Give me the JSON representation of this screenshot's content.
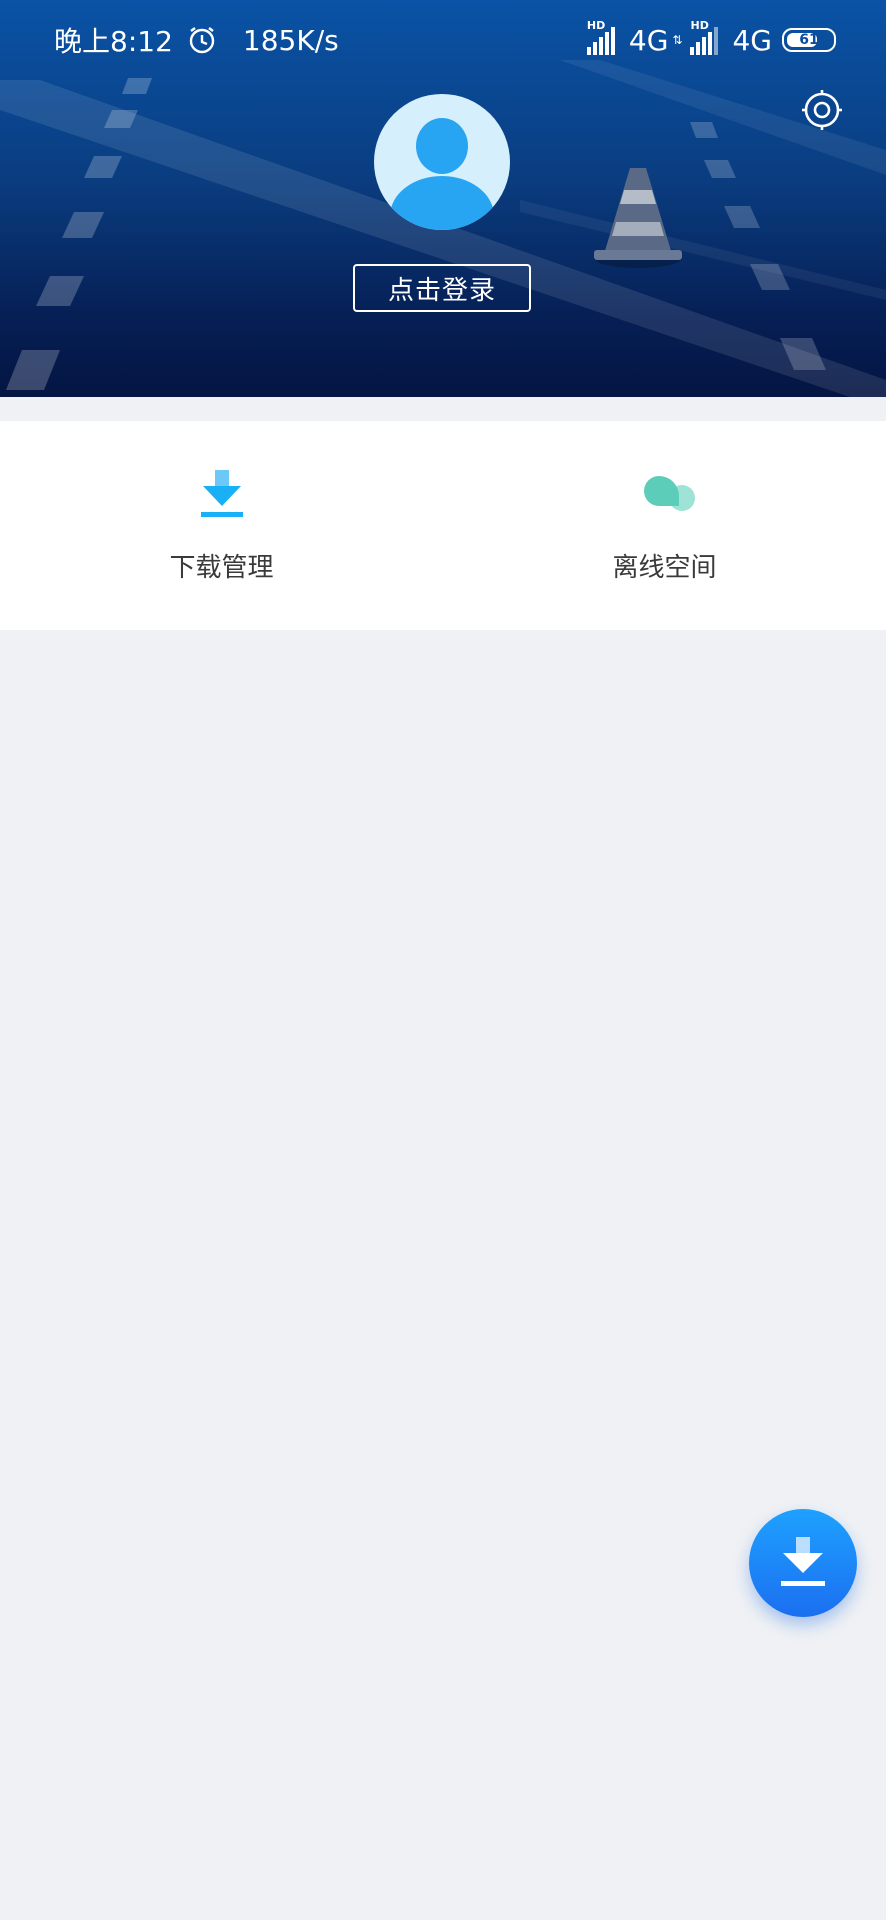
{
  "status_bar": {
    "time": "晚上8:12",
    "speed": "185K/s",
    "network_1": "4G",
    "network_2": "4G",
    "hd_label": "HD",
    "battery": "61"
  },
  "header": {
    "login_label": "点击登录",
    "settings_icon": "settings-icon",
    "avatar_icon": "user-avatar"
  },
  "features": [
    {
      "label": "下载管理",
      "icon": "download-icon"
    },
    {
      "label": "离线空间",
      "icon": "cloud-icon"
    }
  ],
  "fab": {
    "icon": "download-icon"
  },
  "colors": {
    "header_top": "#0a53a6",
    "header_bottom": "#041542",
    "download_blue": "#1ab0f6",
    "cloud_teal": "#5ccdb9",
    "fab_blue": "#1b8bf9",
    "background": "#eff1f4"
  }
}
